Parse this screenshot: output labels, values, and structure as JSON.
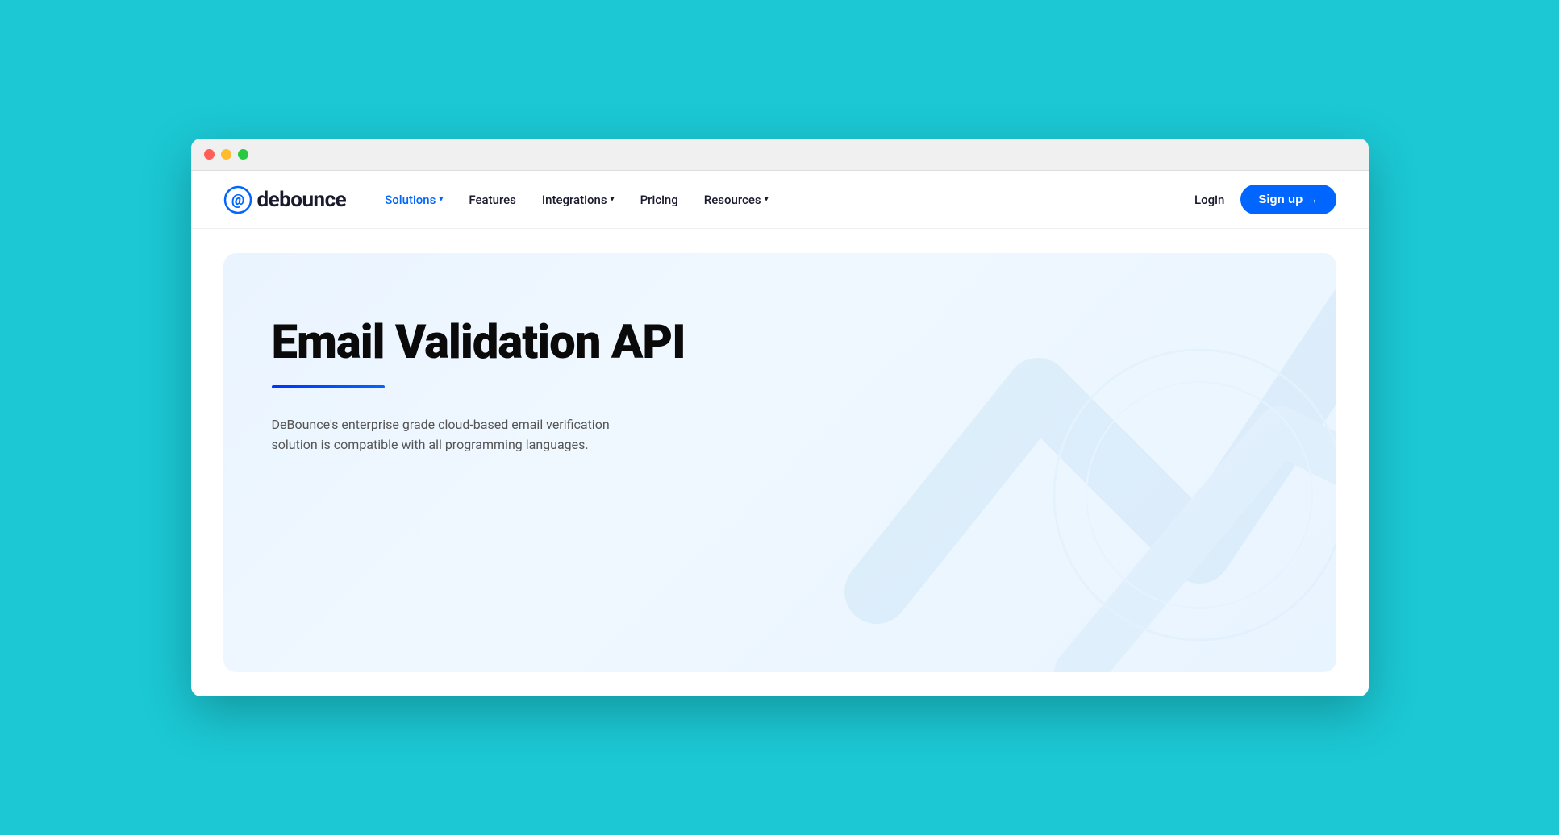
{
  "browser": {
    "traffic_lights": [
      "red",
      "yellow",
      "green"
    ]
  },
  "navbar": {
    "logo_text": "debounce",
    "nav_items": [
      {
        "label": "Solutions",
        "has_dropdown": true,
        "active": true
      },
      {
        "label": "Features",
        "has_dropdown": false,
        "active": false
      },
      {
        "label": "Integrations",
        "has_dropdown": true,
        "active": false
      },
      {
        "label": "Pricing",
        "has_dropdown": false,
        "active": false
      },
      {
        "label": "Resources",
        "has_dropdown": true,
        "active": false
      }
    ],
    "login_label": "Login",
    "signup_label": "Sign up →"
  },
  "hero": {
    "title": "Email Validation API",
    "description": "DeBounce's enterprise grade cloud-based email verification solution is compatible with all programming languages."
  }
}
